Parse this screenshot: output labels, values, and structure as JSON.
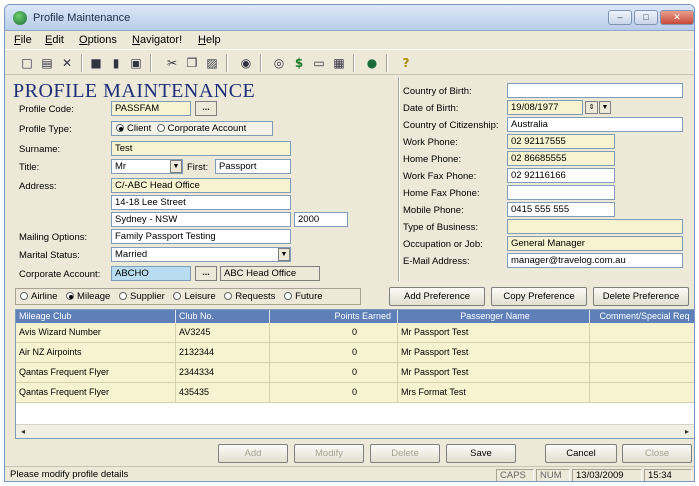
{
  "window": {
    "title": "Profile Maintenance"
  },
  "window_controls": {
    "minimize": "–",
    "maximize": "□",
    "close": "✕"
  },
  "menu": [
    "File",
    "Edit",
    "Options",
    "Navigator!",
    "Help"
  ],
  "toolbar": [
    {
      "icon": "new-document-icon",
      "glyph": "□"
    },
    {
      "icon": "open-folder-icon",
      "glyph": "▤"
    },
    {
      "icon": "delete-x-icon",
      "glyph": "✕"
    },
    {
      "icon": "save-disk-icon",
      "glyph": "■"
    },
    {
      "icon": "trash-icon",
      "glyph": "▮"
    },
    {
      "icon": "print-icon",
      "glyph": "▣"
    },
    {
      "icon": "cut-scissors-icon",
      "glyph": "✂"
    },
    {
      "icon": "copy-icon",
      "glyph": "❐"
    },
    {
      "icon": "paste-icon",
      "glyph": "▨"
    },
    {
      "icon": "camera-icon",
      "glyph": "◉"
    },
    {
      "icon": "binoculars-icon",
      "glyph": "◎"
    },
    {
      "icon": "dollar-icon",
      "glyph": "$"
    },
    {
      "icon": "card-icon",
      "glyph": "▭"
    },
    {
      "icon": "puzzle-icon",
      "glyph": "▦"
    },
    {
      "icon": "globe-icon",
      "glyph": "●"
    },
    {
      "icon": "help-icon",
      "glyph": "?"
    }
  ],
  "heading": "PROFILE MAINTENANCE",
  "form": {
    "profile_code_label": "Profile Code:",
    "profile_code": "PASSFAM",
    "browse": "...",
    "profile_type_label": "Profile Type:",
    "type_client": "Client",
    "type_corporate": "Corporate Account",
    "surname_label": "Surname:",
    "surname": "Test",
    "title_label": "Title:",
    "title_value": "Mr",
    "first_label": "First:",
    "first_name": "Passport",
    "address_label": "Address:",
    "address1": "C/-ABC Head Office",
    "address2": "14-18 Lee Street",
    "address3": "Sydney - NSW",
    "postcode": "2000",
    "mailing_label": "Mailing Options:",
    "mailing": "Family Passport Testing",
    "marital_label": "Marital Status:",
    "marital": "Married",
    "corp_label": "Corporate Account:",
    "corp_code": "ABCHO",
    "corp_name": "ABC Head Office"
  },
  "right": {
    "country_birth_label": "Country of Birth:",
    "country_birth": "",
    "dob_label": "Date of Birth:",
    "dob": "19/08/1977",
    "citizenship_label": "Country of Citizenship:",
    "citizenship": "Australia",
    "work_phone_label": "Work Phone:",
    "work_phone": "02 92117555",
    "home_phone_label": "Home Phone:",
    "home_phone": "02 86685555",
    "work_fax_label": "Work Fax Phone:",
    "work_fax": "02 92116166",
    "home_fax_label": "Home Fax Phone:",
    "home_fax": "",
    "mobile_label": "Mobile Phone:",
    "mobile": "0415 555 555",
    "business_label": "Type of Business:",
    "business": "",
    "occupation_label": "Occupation or Job:",
    "occupation": "General Manager",
    "email_label": "E-Mail Address:",
    "email": "manager@travelog.com.au"
  },
  "categories": [
    "Airline",
    "Mileage",
    "Supplier",
    "Leisure",
    "Requests",
    "Future"
  ],
  "category_selected": "Mileage",
  "pref_buttons": {
    "add": "Add Preference",
    "copy": "Copy Preference",
    "delete": "Delete Preference"
  },
  "grid": {
    "headers": [
      "Mileage Club",
      "Club No.",
      "Points Earned",
      "Passenger Name",
      "Comment/Special Req"
    ],
    "rows": [
      [
        "Avis Wizard Number",
        "AV3245",
        "0",
        "Mr Passport Test",
        ""
      ],
      [
        "Air NZ Airpoints",
        "2132344",
        "0",
        "Mr Passport Test",
        ""
      ],
      [
        "Qantas Frequent Flyer",
        "2344334",
        "0",
        "Mr Passport Test",
        ""
      ],
      [
        "Qantas Frequent Flyer",
        "435435",
        "0",
        "Mrs Format Test",
        ""
      ]
    ]
  },
  "actions": {
    "add": "Add",
    "modify": "Modify",
    "delete": "Delete",
    "save": "Save",
    "cancel": "Cancel",
    "close": "Close"
  },
  "status": {
    "message": "Please modify profile details",
    "caps": "CAPS",
    "num": "NUM",
    "date": "13/03/2009",
    "time": "15:34"
  }
}
